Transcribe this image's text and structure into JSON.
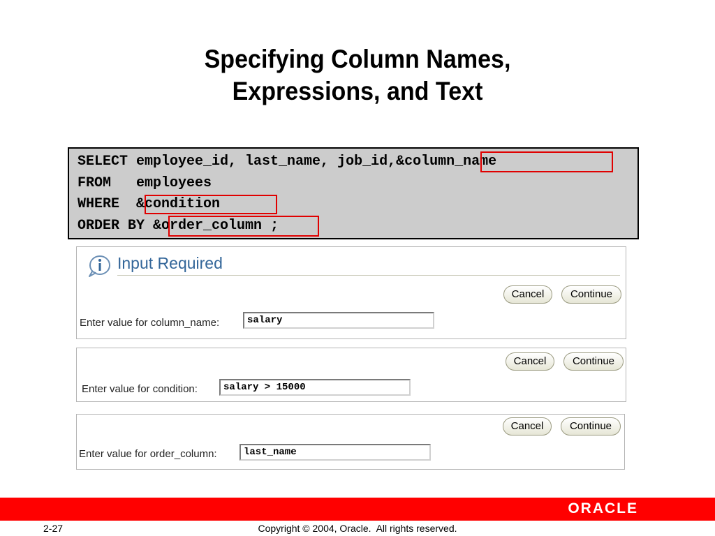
{
  "slide": {
    "title_line1": "Specifying Column Names,",
    "title_line2": "Expressions, and Text"
  },
  "code": {
    "line1_plain": "SELECT employee_id, last_name, job_id,",
    "line1_var": "&column_name",
    "line2": "FROM   employees",
    "line3_keyword": "WHERE",
    "line3_var": "&condition",
    "line4_keyword": "ORDER BY",
    "line4_var": "&order_column",
    "line4_end": ";"
  },
  "dialogs": [
    {
      "title": "Input Required",
      "cancel_label": "Cancel",
      "continue_label": "Continue",
      "field_label": "Enter value for column_name:",
      "field_value": "salary"
    },
    {
      "cancel_label": "Cancel",
      "continue_label": "Continue",
      "field_label": "Enter value for condition:",
      "field_value": "salary > 15000"
    },
    {
      "cancel_label": "Cancel",
      "continue_label": "Continue",
      "field_label": "Enter value for order_column:",
      "field_value": "last_name"
    }
  ],
  "footer": {
    "brand": "ORACLE",
    "page_number": "2-27",
    "copyright": "Copyright © 2004, Oracle.  All rights reserved."
  },
  "colors": {
    "accent_red": "#ff0000",
    "highlight_red": "#e00000",
    "dialog_title_blue": "#336699",
    "code_background": "#cccccc"
  },
  "icons": {
    "info": "info-icon"
  }
}
